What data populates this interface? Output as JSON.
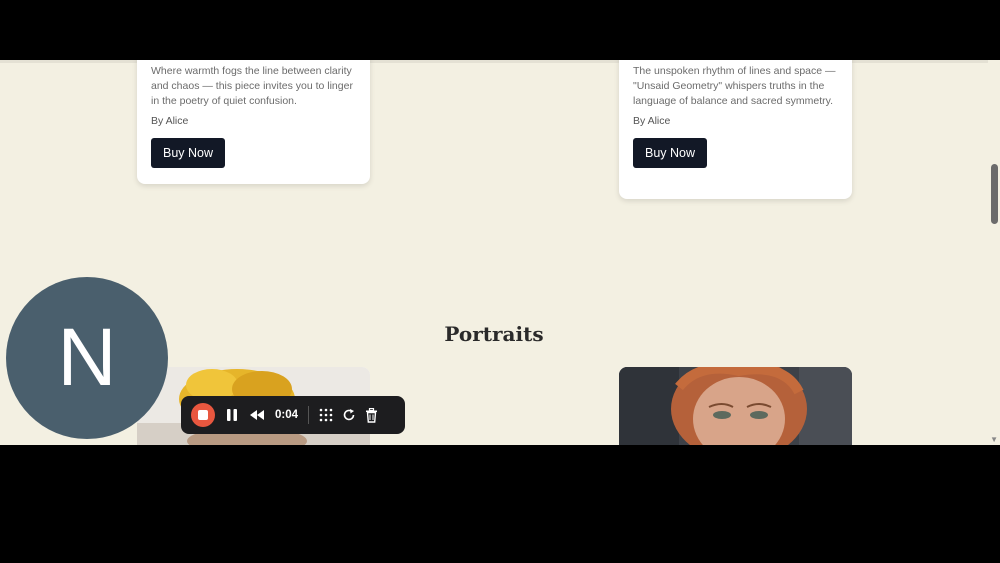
{
  "cards": [
    {
      "description": "Where warmth fogs the line between clarity and chaos — this piece invites you to linger in the poetry of quiet confusion.",
      "author": "By Alice",
      "button_label": "Buy Now"
    },
    {
      "description": "The unspoken rhythm of lines and space — \"Unsaid Geometry\" whispers truths in the language of balance and sacred symmetry.",
      "author": "By Alice",
      "button_label": "Buy Now"
    }
  ],
  "section": {
    "title": "Portraits"
  },
  "avatar": {
    "initial": "N",
    "color": "#4a5f6d"
  },
  "recorder": {
    "elapsed": "0:04",
    "stop_color": "#e9573f",
    "icons": [
      "stop-icon",
      "pause-icon",
      "rewind-icon",
      "grid-icon",
      "restart-icon",
      "trash-icon"
    ]
  },
  "colors": {
    "page_bg": "#f3f0e2",
    "button_bg": "#121826"
  }
}
